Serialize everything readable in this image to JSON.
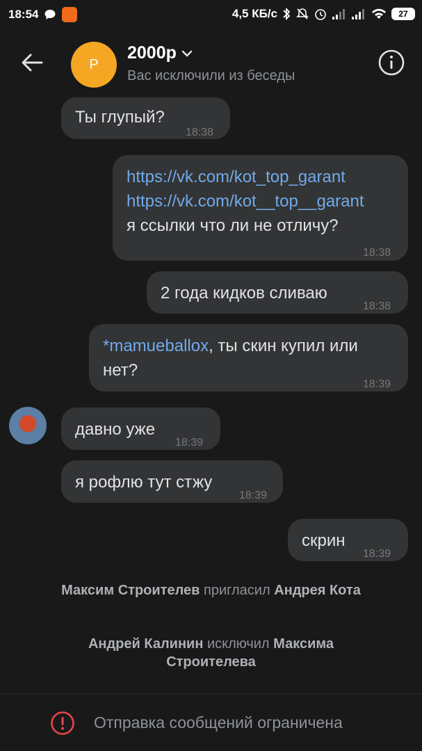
{
  "status_bar": {
    "time": "18:54",
    "network_speed": "4,5 КБ/с",
    "battery": "27",
    "icons": [
      "chat-bubble-icon",
      "app-notification-icon",
      "bluetooth-icon",
      "silent-bell-icon",
      "alarm-icon",
      "signal-1-icon",
      "signal-2-icon",
      "wifi-icon",
      "battery-icon"
    ]
  },
  "header": {
    "avatar_letter": "Р",
    "title": "2000р",
    "subtitle": "Вас исключили из беседы",
    "avatar_color": "#f5a623"
  },
  "messages": [
    {
      "direction": "incoming",
      "text": "Ты глупый?",
      "time": "18:38"
    },
    {
      "direction": "outgoing",
      "lines": [
        "https://vk.com/kot_top_garant",
        "https://vk.com/kot__top__garant",
        "я ссылки что ли не отличу?"
      ],
      "time": "18:38"
    },
    {
      "direction": "outgoing",
      "text": "2 года кидков сливаю",
      "time": "18:38"
    },
    {
      "direction": "outgoing",
      "mention": "*mamueballox",
      "text_after_mention": ", ты скин купил или",
      "line2": "нет?",
      "time": "18:39"
    },
    {
      "direction": "incoming",
      "text": "давно уже",
      "time": "18:39"
    },
    {
      "direction": "incoming",
      "text": "я рофлю тут стжу",
      "time": "18:39"
    },
    {
      "direction": "outgoing",
      "text": "скрин",
      "time": "18:39"
    }
  ],
  "service_messages": [
    {
      "actor": "Максим Строителев",
      "action": " пригласил ",
      "target": "Андрея Кота"
    },
    {
      "actor": "Андрей Калинин",
      "action": " исключил ",
      "target": "Максима Строителева"
    }
  ],
  "footer": {
    "text": "Отправка сообщений ограничена"
  },
  "colors": {
    "background": "#19191a",
    "bubble": "#333435",
    "link": "#71aaeb",
    "alert": "#e64646"
  }
}
